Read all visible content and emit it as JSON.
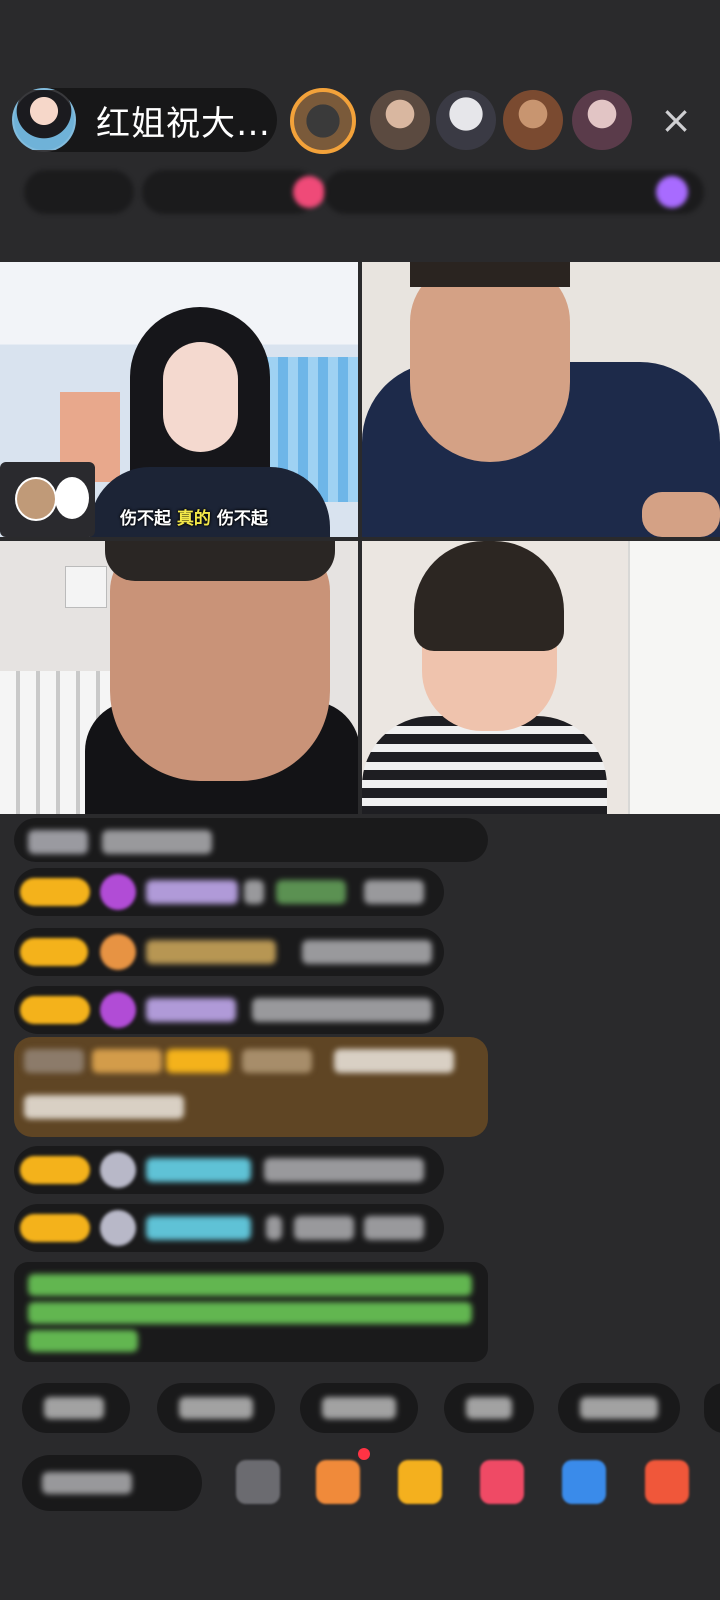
{
  "colors": {
    "background": "#2a2a2c",
    "accent_gold": "#f4b21b",
    "caption_highlight": "#f3e84a"
  },
  "header": {
    "host_name": "红姐祝大…",
    "close_icon": "×"
  },
  "video": {
    "caption_part1": "伤不起 ",
    "caption_highlight": "真的",
    "caption_part2": " 伤不起"
  }
}
